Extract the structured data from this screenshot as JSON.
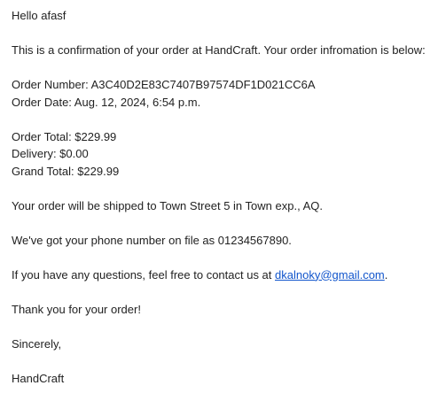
{
  "email": {
    "greeting": "Hello afasf",
    "intro": "This is a confirmation of your order at HandCraft. Your order infromation is below:",
    "order_number": "Order Number: A3C40D2E83C7407B97574DF1D021CC6A",
    "order_date": "Order Date: Aug. 12, 2024, 6:54 p.m.",
    "order_total": "Order Total: $229.99",
    "delivery": "Delivery: $0.00",
    "grand_total": "Grand Total: $229.99",
    "shipping": "Your order will be shipped to Town Street 5 in Town exp., AQ.",
    "phone": "We've got your phone number on file as 01234567890.",
    "contact_prefix": "If you have any questions, feel free to contact us at ",
    "contact_email": "dkalnoky@gmail.com",
    "contact_suffix": ".",
    "thanks": "Thank you for your order!",
    "closing": "Sincerely,",
    "signature": "HandCraft"
  },
  "colors": {
    "text": "#222222",
    "link": "#1155cc",
    "background": "#ffffff"
  }
}
